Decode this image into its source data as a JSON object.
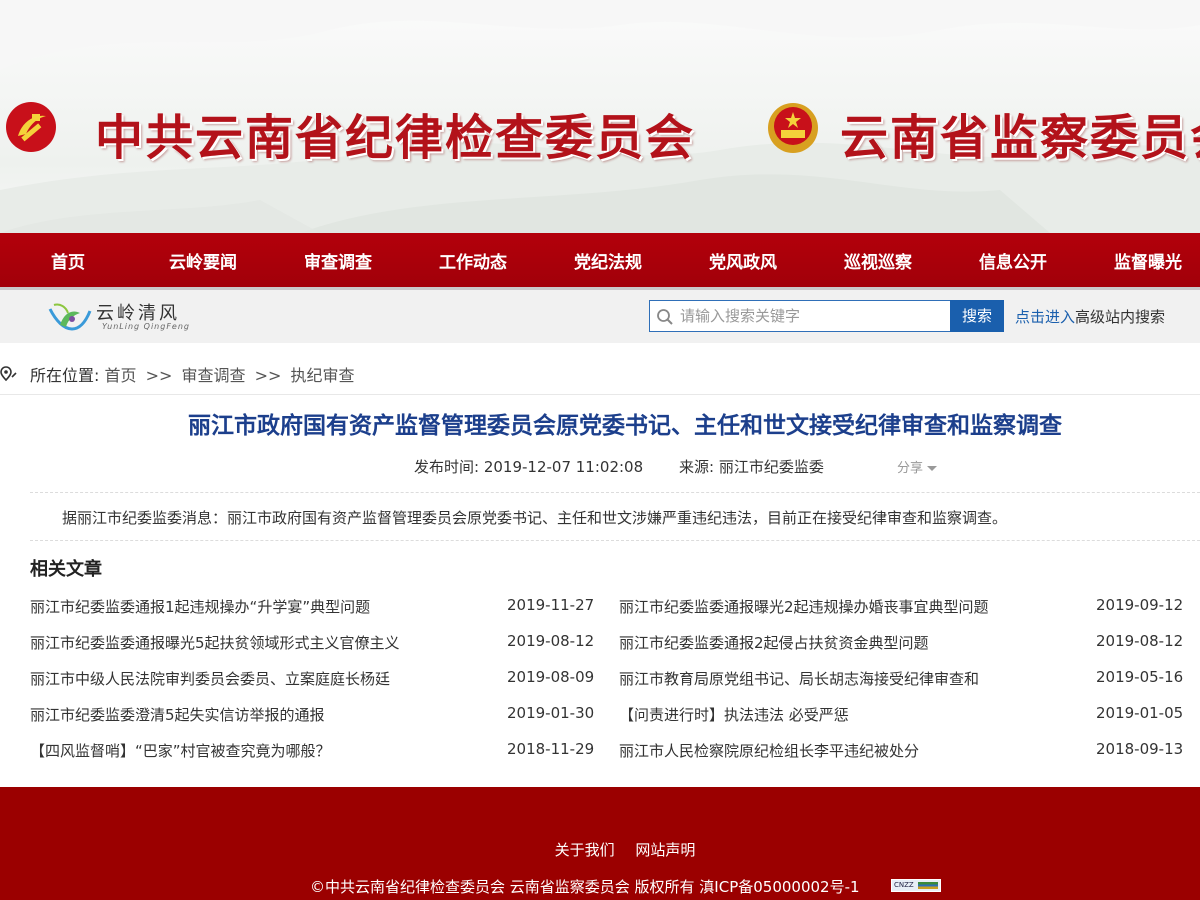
{
  "banner": {
    "title_left": "中共云南省纪律检查委员会",
    "title_right": "云南省监察委员会",
    "emblem_left_icon": "party-emblem-icon",
    "emblem_right_icon": "national-emblem-icon",
    "accent_color": "#b3121a"
  },
  "nav": {
    "items": [
      {
        "label": "首页"
      },
      {
        "label": "云岭要闻"
      },
      {
        "label": "审查调查"
      },
      {
        "label": "工作动态"
      },
      {
        "label": "党纪法规"
      },
      {
        "label": "党风政风"
      },
      {
        "label": "巡视巡察"
      },
      {
        "label": "信息公开"
      },
      {
        "label": "监督曝光"
      }
    ],
    "background_color": "#a8000a"
  },
  "logo": {
    "cn": "云岭清风",
    "en": "YunLing QingFeng"
  },
  "search": {
    "placeholder": "请输入搜索关键字",
    "button_label": "搜索",
    "advanced_link": "点击进入",
    "advanced_rest": "高级站内搜索"
  },
  "breadcrumb": {
    "prefix": "所在位置:",
    "items": [
      "首页",
      "审查调查",
      "执纪审查"
    ],
    "separator": ">>"
  },
  "article": {
    "title": "丽江市政府国有资产监督管理委员会原党委书记、主任和世文接受纪律审查和监察调查",
    "publish_time": "发布时间: 2019-12-07 11:02:08",
    "source": "来源: 丽江市纪委监委",
    "share_label": "分享",
    "body": "据丽江市纪委监委消息：丽江市政府国有资产监督管理委员会原党委书记、主任和世文涉嫌严重违纪违法，目前正在接受纪律审查和监察调查。"
  },
  "related": {
    "heading": "相关文章",
    "left": [
      {
        "title": "丽江市纪委监委通报1起违规操办“升学宴”典型问题",
        "date": "2019-11-27"
      },
      {
        "title": "丽江市纪委监委通报曝光5起扶贫领域形式主义官僚主义",
        "date": "2019-08-12"
      },
      {
        "title": "丽江市中级人民法院审判委员会委员、立案庭庭长杨廷",
        "date": "2019-08-09"
      },
      {
        "title": "丽江市纪委监委澄清5起失实信访举报的通报",
        "date": "2019-01-30"
      },
      {
        "title": "【四风监督哨】“巴家”村官被查究竟为哪般？",
        "date": "2018-11-29"
      }
    ],
    "right": [
      {
        "title": "丽江市纪委监委通报曝光2起违规操办婚丧事宜典型问题",
        "date": "2019-09-12"
      },
      {
        "title": "丽江市纪委监委通报2起侵占扶贫资金典型问题",
        "date": "2019-08-12"
      },
      {
        "title": "丽江市教育局原党组书记、局长胡志海接受纪律审查和",
        "date": "2019-05-16"
      },
      {
        "title": "【问责进行时】执法违法 必受严惩",
        "date": "2019-01-05"
      },
      {
        "title": "丽江市人民检察院原纪检组长李平违纪被处分",
        "date": "2018-09-13"
      }
    ]
  },
  "footer": {
    "links": [
      "关于我们",
      "网站声明"
    ],
    "copyright": "©中共云南省纪律检查委员会 云南省监察委员会 版权所有 滇ICP备05000002号-1",
    "badge": "CNZZ",
    "background_color": "#9b0000"
  }
}
